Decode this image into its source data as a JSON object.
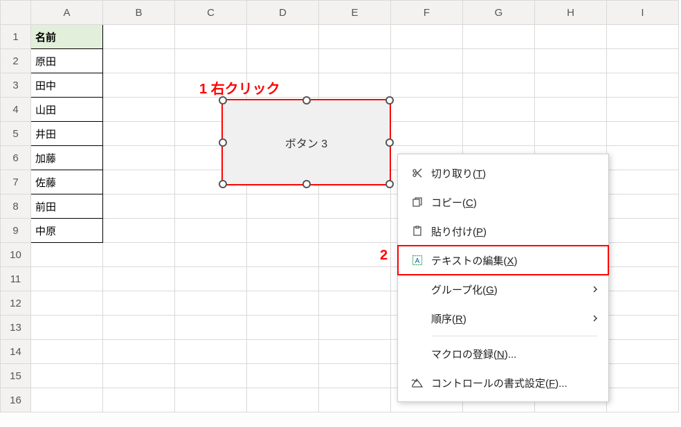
{
  "columns": [
    "A",
    "B",
    "C",
    "D",
    "E",
    "F",
    "G",
    "H",
    "I"
  ],
  "rows": [
    "1",
    "2",
    "3",
    "4",
    "5",
    "6",
    "7",
    "8",
    "9",
    "10",
    "11",
    "12",
    "13",
    "14",
    "15",
    "16"
  ],
  "cells": {
    "A1": "名前",
    "A2": "原田",
    "A3": "田中",
    "A4": "山田",
    "A5": "井田",
    "A6": "加藤",
    "A7": "佐藤",
    "A8": "前田",
    "A9": "中原"
  },
  "button_shape": {
    "label": "ボタン 3"
  },
  "annotation": {
    "step1": "1 右クリック",
    "step2": "2"
  },
  "context_menu": {
    "cut": {
      "text": "切り取り(",
      "accel": "T",
      "suffix": ")"
    },
    "copy": {
      "text": "コピー(",
      "accel": "C",
      "suffix": ")"
    },
    "paste": {
      "text": "貼り付け(",
      "accel": "P",
      "suffix": ")"
    },
    "edit_text": {
      "text": "テキストの編集(",
      "accel": "X",
      "suffix": ")"
    },
    "group": {
      "text": "グループ化(",
      "accel": "G",
      "suffix": ")"
    },
    "order": {
      "text": "順序(",
      "accel": "R",
      "suffix": ")"
    },
    "assign": {
      "text": "マクロの登録(",
      "accel": "N",
      "suffix": ")..."
    },
    "format": {
      "text": "コントロールの書式設定(",
      "accel": "F",
      "suffix": ")..."
    }
  }
}
